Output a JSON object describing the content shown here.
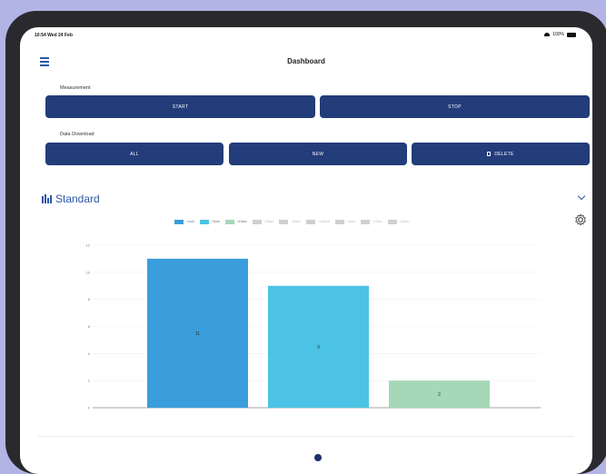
{
  "status": {
    "time": "10:54  Wed 24 Feb",
    "battery": "100%"
  },
  "nav": {
    "title": "Dashboard",
    "menu_icon": "hamburger-icon"
  },
  "measurement": {
    "label": "Measurement",
    "start": "START",
    "stop": "STOP"
  },
  "download": {
    "label": "Data Download",
    "all": "ALL",
    "new": "NEW",
    "delete": "DELETE"
  },
  "card": {
    "title": "Standard",
    "icon": "bar-chart-icon"
  },
  "legend": [
    {
      "label": ">1um",
      "color": "#3a9ddc",
      "active": true
    },
    {
      "label": ">5um",
      "color": "#4cc3e4",
      "active": true
    },
    {
      "label": ">10um",
      "color": "#a4d8b8",
      "active": true
    },
    {
      "label": ">25um",
      "color": "#d0d0d0",
      "active": false
    },
    {
      "label": ">50um",
      "color": "#d0d0d0",
      "active": false
    },
    {
      "label": ">100um",
      "color": "#d0d0d0",
      "active": false
    },
    {
      "label": ">5um",
      "color": "#d0d0d0",
      "active": false
    },
    {
      "label": ">10um",
      "color": "#d0d0d0",
      "active": false
    },
    {
      "label": ">25um",
      "color": "#d0d0d0",
      "active": false
    }
  ],
  "chart_data": {
    "type": "bar",
    "categories": [
      ">1um",
      ">5um",
      ">10um"
    ],
    "values": [
      11,
      9,
      2
    ],
    "colors": [
      "#3a9ddc",
      "#4cc3e4",
      "#a4d8b8"
    ],
    "ylim": [
      0,
      12
    ],
    "yticks": [
      0,
      2,
      4,
      6,
      8,
      10,
      12
    ],
    "grid": true,
    "legend_position": "top"
  }
}
